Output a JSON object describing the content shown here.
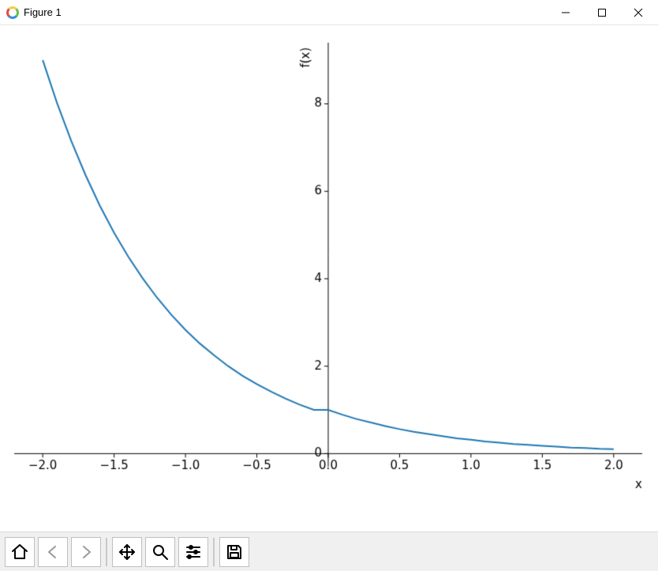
{
  "window": {
    "title": "Figure 1",
    "controls": {
      "minimize": "–",
      "maximize": "☐",
      "close": "✕"
    }
  },
  "toolbar": {
    "home": "Home",
    "back": "Back",
    "forward": "Forward",
    "pan": "Pan",
    "zoom": "Zoom",
    "subplots": "Configure subplots",
    "save": "Save"
  },
  "colors": {
    "line": "#1f77b4",
    "axes": "#000000",
    "ticks": "#000000"
  },
  "chart_data": {
    "type": "line",
    "title": "",
    "xlabel": "x",
    "ylabel": "f(x)",
    "xlim": [
      -2.2,
      2.2
    ],
    "ylim": [
      -0.3,
      9.4
    ],
    "xticks": [
      -2.0,
      -1.5,
      -1.0,
      -0.5,
      0.0,
      0.5,
      1.0,
      1.5,
      2.0
    ],
    "yticks": [
      0,
      2,
      4,
      6,
      8
    ],
    "xtick_labels": [
      "−2.0",
      "−1.5",
      "−1.0",
      "−0.5",
      "0.0",
      "0.5",
      "1.0",
      "1.5",
      "2.0"
    ],
    "ytick_labels": [
      "0",
      "2",
      "4",
      "6",
      "8"
    ],
    "axis_zero_cross": true,
    "series": [
      {
        "name": "f(x)",
        "color": "#1f77b4",
        "x": [
          -2.0,
          -1.9,
          -1.8,
          -1.7,
          -1.6,
          -1.5,
          -1.4,
          -1.3,
          -1.2,
          -1.1,
          -1.0,
          -0.9,
          -0.8,
          -0.7,
          -0.6,
          -0.5,
          -0.4,
          -0.3,
          -0.2,
          -0.1,
          0.0,
          0.1,
          0.2,
          0.3,
          0.4,
          0.5,
          0.6,
          0.7,
          0.8,
          0.9,
          1.0,
          1.1,
          1.2,
          1.3,
          1.4,
          1.5,
          1.6,
          1.7,
          1.8,
          1.9,
          2.0
        ],
        "y": [
          9.0,
          8.02,
          7.15,
          6.37,
          5.67,
          5.05,
          4.5,
          4.01,
          3.57,
          3.18,
          2.83,
          2.52,
          2.25,
          2.0,
          1.78,
          1.59,
          1.42,
          1.26,
          1.12,
          1.0,
          1.0,
          0.89,
          0.79,
          0.71,
          0.63,
          0.56,
          0.5,
          0.45,
          0.4,
          0.35,
          0.32,
          0.28,
          0.25,
          0.22,
          0.2,
          0.18,
          0.16,
          0.14,
          0.13,
          0.11,
          0.1
        ]
      }
    ]
  }
}
